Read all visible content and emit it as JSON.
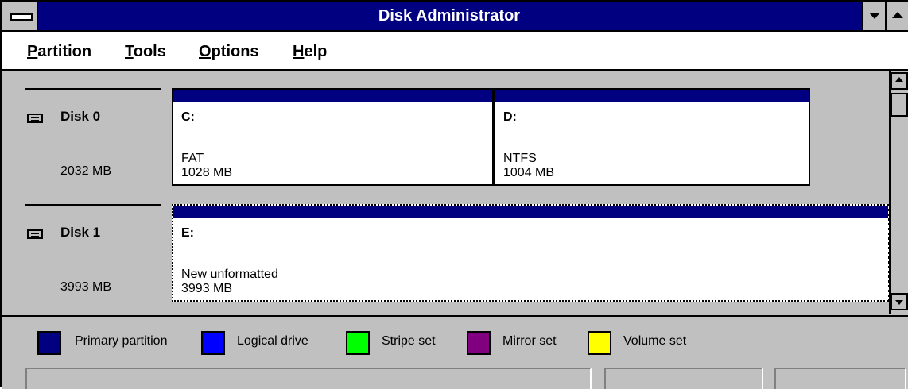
{
  "window": {
    "title": "Disk Administrator"
  },
  "menu": {
    "items": [
      {
        "u": "P",
        "rest": "artition"
      },
      {
        "u": "T",
        "rest": "ools"
      },
      {
        "u": "O",
        "rest": "ptions"
      },
      {
        "u": "H",
        "rest": "elp"
      }
    ]
  },
  "disks": [
    {
      "name": "Disk 0",
      "size": "2032 MB",
      "partitions": [
        {
          "letter": "C:",
          "fs": "FAT",
          "size": "1028 MB"
        },
        {
          "letter": "D:",
          "fs": "NTFS",
          "size": "1004 MB"
        }
      ]
    },
    {
      "name": "Disk 1",
      "size": "3993 MB",
      "partitions": [
        {
          "letter": "E:",
          "fs": "New unformatted",
          "size": "3993 MB"
        }
      ]
    }
  ],
  "legend": [
    {
      "label": "Primary partition",
      "color": "#000080"
    },
    {
      "label": "Logical drive",
      "color": "#0000ff"
    },
    {
      "label": "Stripe set",
      "color": "#00ff00"
    },
    {
      "label": "Mirror set",
      "color": "#800080"
    },
    {
      "label": "Volume set",
      "color": "#ffff00"
    }
  ],
  "colors": {
    "titlebar": "#000080",
    "face": "#c0c0c0",
    "partition_header": "#000080"
  }
}
